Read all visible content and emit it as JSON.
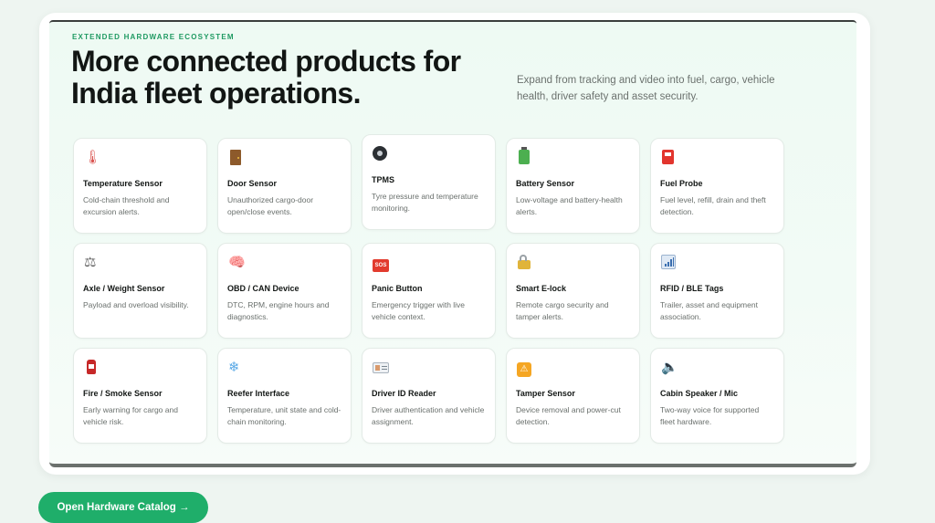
{
  "section": {
    "eyebrow": "EXTENDED HARDWARE ECOSYSTEM",
    "headline": "More connected products for India fleet operations.",
    "intro": "Expand from tracking and video into fuel, cargo, vehicle health, driver safety and asset security."
  },
  "products": [
    {
      "icon": "thermometer-icon",
      "title": "Temperature Sensor",
      "desc": "Cold-chain threshold and excursion alerts."
    },
    {
      "icon": "door-icon",
      "title": "Door Sensor",
      "desc": "Unauthorized cargo-door open/close events."
    },
    {
      "icon": "tire-icon",
      "title": "TPMS",
      "desc": "Tyre pressure and temperature monitoring."
    },
    {
      "icon": "battery-icon",
      "title": "Battery Sensor",
      "desc": "Low-voltage and battery-health alerts."
    },
    {
      "icon": "fuel-pump-icon",
      "title": "Fuel Probe",
      "desc": "Fuel level, refill, drain and theft detection."
    },
    {
      "icon": "scale-icon",
      "title": "Axle / Weight Sensor",
      "desc": "Payload and overload visibility."
    },
    {
      "icon": "brain-icon",
      "title": "OBD / CAN Device",
      "desc": "DTC, RPM, engine hours and diagnostics."
    },
    {
      "icon": "sos-icon",
      "title": "Panic Button",
      "desc": "Emergency trigger with live vehicle context."
    },
    {
      "icon": "lock-icon",
      "title": "Smart E-lock",
      "desc": "Remote cargo security and tamper alerts."
    },
    {
      "icon": "signal-bars-icon",
      "title": "RFID / BLE Tags",
      "desc": "Trailer, asset and equipment association."
    },
    {
      "icon": "fire-extinguisher-icon",
      "title": "Fire / Smoke Sensor",
      "desc": "Early warning for cargo and vehicle risk."
    },
    {
      "icon": "snowflake-icon",
      "title": "Reefer Interface",
      "desc": "Temperature, unit state and cold-chain monitoring."
    },
    {
      "icon": "id-card-icon",
      "title": "Driver ID Reader",
      "desc": "Driver authentication and vehicle assignment."
    },
    {
      "icon": "tamper-icon",
      "title": "Tamper Sensor",
      "desc": "Device removal and power-cut detection."
    },
    {
      "icon": "speaker-icon",
      "title": "Cabin Speaker / Mic",
      "desc": "Two-way voice for supported fleet hardware."
    }
  ],
  "glyphs": {
    "thermometer": "🌡",
    "scale": "⚖",
    "brain": "🧠",
    "snowflake": "❄",
    "speaker": "🔈",
    "sos": "SOS",
    "tamper": "⚠"
  },
  "cta": {
    "label": "Open Hardware Catalog →"
  },
  "colors": {
    "accent": "#1fae6a",
    "eyebrow": "#1f9a62",
    "heading": "#121614",
    "body": "#6b716e"
  }
}
